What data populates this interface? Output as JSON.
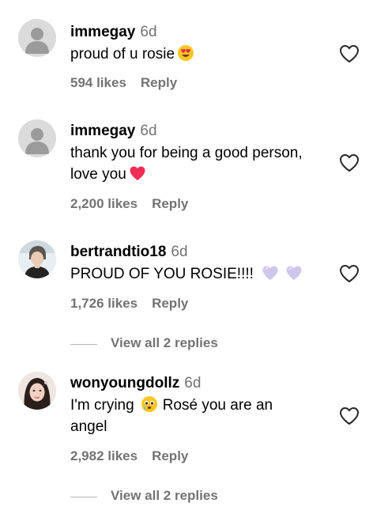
{
  "comments": [
    {
      "username": "immegay",
      "age": "6d",
      "text": "proud of u rosie",
      "emoji": "heart-eyes-emoji",
      "likes": "594 likes",
      "reply": "Reply",
      "avatar": "default-avatar"
    },
    {
      "username": "immegay",
      "age": "6d",
      "text_line1": "thank you for being a good person,",
      "text_line2": "love you",
      "emoji": "red-heart-emoji",
      "likes": "2,200 likes",
      "reply": "Reply",
      "avatar": "default-avatar"
    },
    {
      "username": "bertrandtio18",
      "age": "6d",
      "text": "PROUD OF YOU ROSIE!!!!",
      "emoji": "purple-heart-emoji",
      "likes": "1,726 likes",
      "reply": "Reply",
      "view_replies": "View all 2 replies",
      "avatar": "profile-photo"
    },
    {
      "username": "wonyoungdollz",
      "age": "6d",
      "text_part1": "I'm crying",
      "text_part2": "Rosé you are an",
      "text_line2": "angel",
      "emoji": "crying-face-emoji",
      "likes": "2,982 likes",
      "reply": "Reply",
      "view_replies": "View all 2 replies",
      "avatar": "profile-photo"
    }
  ],
  "colors": {
    "secondary_text": "#737373",
    "heart_red": "#ef2d56",
    "purple_heart": "#cfc6ee"
  }
}
